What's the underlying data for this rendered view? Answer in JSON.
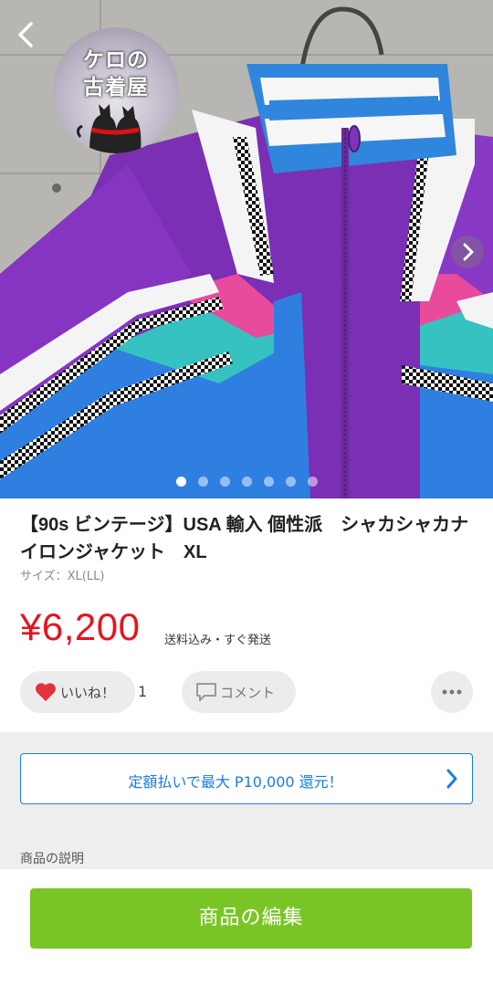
{
  "shop": {
    "logo_line1": "ケロの",
    "logo_line2": "古着屋"
  },
  "gallery": {
    "total_images": 7,
    "active_index": 0
  },
  "product": {
    "title": "【90s ビンテージ】USA 輸入 個性派　シャカシャカナイロンジャケット　XL",
    "size_label": "サイズ：XL(LL)",
    "price": "¥6,200",
    "price_note": "送料込み・すぐ発送"
  },
  "actions": {
    "like_label": "いいね！",
    "like_count": "1",
    "comment_label": "コメント"
  },
  "promo": {
    "text": "定額払いで最大 P10,000 還元！"
  },
  "description": {
    "heading": "商品の説明"
  },
  "footer": {
    "edit_button": "商品の編集"
  },
  "colors": {
    "price": "#e4151f",
    "accent_blue": "#1a7ce0",
    "edit_button": "#7ac526",
    "like_heart": "#e0333b"
  },
  "icons": {
    "back": "back-arrow-icon",
    "next": "chevron-right-icon",
    "like": "heart-icon",
    "comment": "speech-bubble-icon",
    "more": "more-dots-icon",
    "promo": "chevron-right-icon"
  }
}
